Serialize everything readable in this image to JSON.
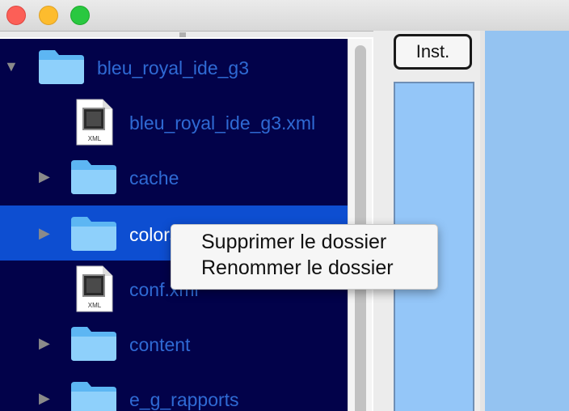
{
  "window": {
    "buttons": [
      "close",
      "minimize",
      "zoom"
    ]
  },
  "tree": {
    "items": [
      {
        "label": "bleu_royal_ide_g3",
        "type": "folder",
        "expanded": true,
        "selected": false
      },
      {
        "label": "bleu_royal_ide_g3.xml",
        "type": "xml-file",
        "file_badge": "XML",
        "selected": false
      },
      {
        "label": "cache",
        "type": "folder",
        "expanded": false,
        "selected": false
      },
      {
        "label": "colorst",
        "type": "folder",
        "expanded": false,
        "selected": true
      },
      {
        "label": "conf.xml",
        "type": "xml-file",
        "file_badge": "XML",
        "selected": false
      },
      {
        "label": "content",
        "type": "folder",
        "expanded": false,
        "selected": false
      },
      {
        "label": "e_g_rapports",
        "type": "folder",
        "expanded": false,
        "selected": false
      }
    ]
  },
  "side_panel": {
    "inst_button_label": "Inst."
  },
  "context_menu": {
    "items": [
      "Supprimer le dossier",
      "Renommer le dossier"
    ]
  },
  "colors": {
    "tree_background": "#02024a",
    "selection": "#0d4ed1",
    "item_text": "#2f6ad4",
    "folder_light": "#8ed0fb",
    "folder_dark": "#5db6f3",
    "preview_blue": "#94c6f8",
    "close_red": "#fc5f57",
    "minimize_yellow": "#fdbc2e",
    "zoom_green": "#29c840"
  }
}
